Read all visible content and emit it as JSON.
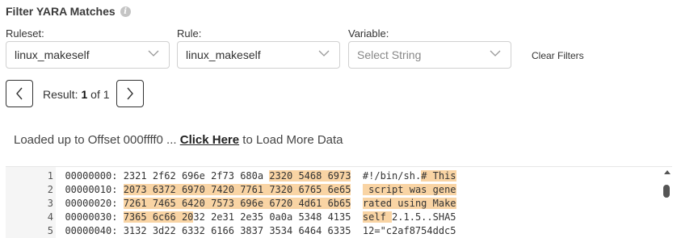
{
  "filter": {
    "title": "Filter YARA Matches",
    "info_icon": "info-icon",
    "ruleset": {
      "label": "Ruleset:",
      "value": "linux_makeself"
    },
    "rule": {
      "label": "Rule:",
      "value": "linux_makeself"
    },
    "variable": {
      "label": "Variable:",
      "placeholder": "Select String"
    },
    "clear_label": "Clear Filters"
  },
  "pager": {
    "prev_icon": "chevron-left-icon",
    "next_icon": "chevron-right-icon",
    "result_prefix": "Result:",
    "current": "1",
    "of_text": "of 1"
  },
  "loader": {
    "prefix": "Loaded up to Offset 000ffff0 ... ",
    "link": "Click Here",
    "suffix": " to Load More Data"
  },
  "hexdump": {
    "highlight_color": "#f9d4a4",
    "lines": [
      {
        "num": "1",
        "segments": [
          {
            "text": "00000000: 2321 2f62 696e 2f73 680a ",
            "hl": false
          },
          {
            "text": "2320 5468 6973",
            "hl": true
          },
          {
            "text": "  #!/bin/sh.",
            "hl": false
          },
          {
            "text": "# This",
            "hl": true
          }
        ]
      },
      {
        "num": "2",
        "segments": [
          {
            "text": "00000010: ",
            "hl": false
          },
          {
            "text": "2073 6372 6970 7420 7761 7320 6765 6e65",
            "hl": true
          },
          {
            "text": "  ",
            "hl": false
          },
          {
            "text": " script was gene",
            "hl": true
          }
        ]
      },
      {
        "num": "3",
        "segments": [
          {
            "text": "00000020: ",
            "hl": false
          },
          {
            "text": "7261 7465 6420 7573 696e 6720 4d61 6b65",
            "hl": true
          },
          {
            "text": "  ",
            "hl": false
          },
          {
            "text": "rated using Make",
            "hl": true
          }
        ]
      },
      {
        "num": "4",
        "segments": [
          {
            "text": "00000030: ",
            "hl": false
          },
          {
            "text": "7365 6c66 20",
            "hl": true
          },
          {
            "text": "32 2e31 2e35 0a0a 5348 4135  ",
            "hl": false
          },
          {
            "text": "self ",
            "hl": true
          },
          {
            "text": "2.1.5..SHA5",
            "hl": false
          }
        ]
      },
      {
        "num": "5",
        "segments": [
          {
            "text": "00000040: 3132 3d22 6332 6166 3837 3534 6464 6335  12=\"c2af8754ddc5",
            "hl": false
          }
        ]
      }
    ]
  }
}
